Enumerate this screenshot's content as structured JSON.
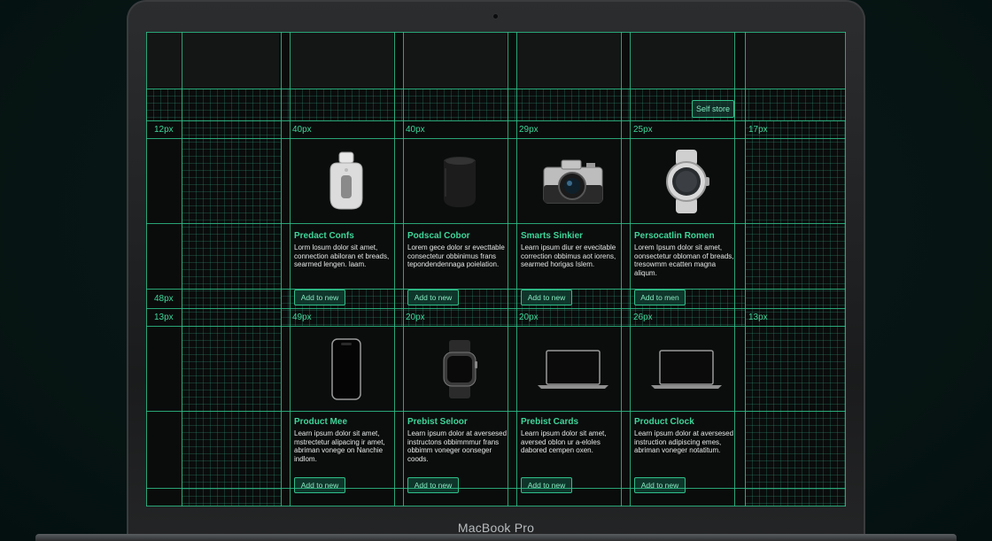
{
  "device": {
    "brand": "MacBook Pro"
  },
  "header": {
    "store_button": "Self store"
  },
  "gaps": {
    "row1": [
      "12px",
      "40px",
      "40px",
      "29px",
      "25px",
      "17px"
    ],
    "mid": "48px",
    "row2": [
      "13px",
      "49px",
      "20px",
      "20px",
      "26px",
      "13px"
    ]
  },
  "products": [
    {
      "title": "Predact Confs",
      "desc": "Lorm losum dolor sit amet, connection abiloran et breads, searmed lengen. laam.",
      "button": "Add to new",
      "icon": "airtag-icon"
    },
    {
      "title": "Podscal Cobor",
      "desc": "Lorem gece dolor sr evecttable consectetur obbinimus frans tepondendennaga poielation.",
      "button": "Add to new",
      "icon": "homepod-icon"
    },
    {
      "title": "Smarts Sinkier",
      "desc": "Learn ipsum diur er evecitable correction obbimus aot iorens, searmed horigas Islem.",
      "button": "Add to new",
      "icon": "camera-icon"
    },
    {
      "title": "Persocatlin Romen",
      "desc": "Lorem Ipsum dolor sit amet, oonsectetur obloman of breads, tresowmm ecatten magna aliqum.",
      "button": "Add to men",
      "icon": "smartwatch-icon"
    },
    {
      "title": "Product Mee",
      "desc": "Learn ipsum dolor sit amet, mstrectetur alipacing ir amet, abriman vonege on Nanchie indlom.",
      "button": "Add to new",
      "icon": "phone-icon"
    },
    {
      "title": "Prebist Seloor",
      "desc": "Learn ipsum dolor at aversesed instructons obbimmmur frans obbimm voneger oonseger coods.",
      "button": "Add to new",
      "icon": "applewatch-icon"
    },
    {
      "title": "Prebist Cards",
      "desc": "Learn ipsum dolor sit amet, aversed oblon ur a-eloles dabored cempen oxen.",
      "button": "Add to new",
      "icon": "laptop-icon"
    },
    {
      "title": "Product Clock",
      "desc": "Learn ipsum dolor at aversesed instruction adipiscing emes, abriman voneger notatitum.",
      "button": "Add to new",
      "icon": "laptop-icon"
    }
  ],
  "colors": {
    "accent": "#3fd69a",
    "grid": "#2fbf8a",
    "background": "#071614"
  }
}
